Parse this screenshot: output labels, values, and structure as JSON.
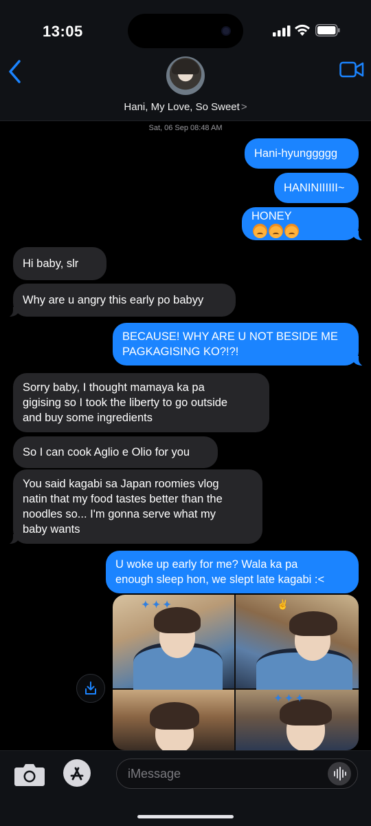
{
  "status_bar": {
    "time": "13:05"
  },
  "contact": {
    "name": "Hani, My Love, So Sweet",
    "chevron": ">"
  },
  "conversation": {
    "timestamp": "Sat, 06 Sep 08:48 AM",
    "messages": [
      {
        "from": "me",
        "text": "Hani-hyunggggg"
      },
      {
        "from": "me",
        "text": "HANINIIIIII~"
      },
      {
        "from": "me",
        "text": "HONEY",
        "emoji": [
          "angry-face",
          "angry-face",
          "angry-face"
        ]
      },
      {
        "from": "them",
        "text": "Hi baby, slr"
      },
      {
        "from": "them",
        "text": "Why are u angry this early po babyy"
      },
      {
        "from": "me",
        "text": "BECAUSE! WHY ARE U NOT BESIDE ME\nPAGKAGISING KO?!?!"
      },
      {
        "from": "them",
        "text": "Sorry baby, I thought mamaya ka pa\ngigising so I took the liberty to go outside\nand buy some ingredients"
      },
      {
        "from": "them",
        "text": "So I can cook Aglio e Olio for you"
      },
      {
        "from": "them",
        "text": "You said kagabi sa Japan roomies vlog\nnatin that my food tastes better than the\nnoodles so... I'm gonna serve what my\nbaby wants"
      },
      {
        "from": "me",
        "text": "U woke up early for me? Wala ka pa\nenough sleep hon, we slept late kagabi :<"
      }
    ]
  },
  "input": {
    "placeholder": "iMessage"
  },
  "colors": {
    "outgoing_bubble": "#1b84ff",
    "incoming_bubble": "#262629",
    "accent": "#1b84ff"
  }
}
